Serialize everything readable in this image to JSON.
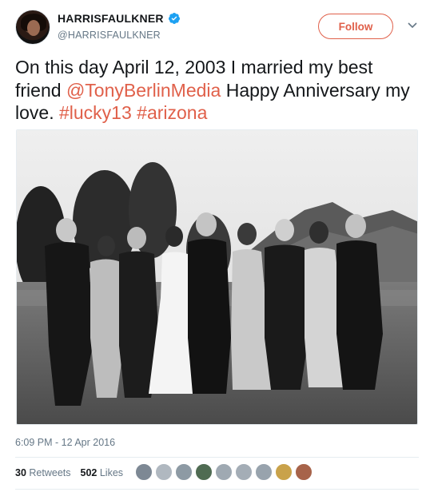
{
  "author": {
    "display_name": "HARRISFAULKNER",
    "handle": "@HARRISFAULKNER",
    "verified": true
  },
  "follow_label": "Follow",
  "tweet": {
    "text_parts": [
      {
        "text": "On this day April 12, 2003 I married my best friend ",
        "type": "text"
      },
      {
        "text": "@TonyBerlinMedia",
        "type": "mention"
      },
      {
        "text": " Happy Anniversary my love.  ",
        "type": "text"
      },
      {
        "text": "#lucky13",
        "type": "hashtag"
      },
      {
        "text": " ",
        "type": "text"
      },
      {
        "text": "#arizona",
        "type": "hashtag"
      }
    ]
  },
  "timestamp": "6:09 PM - 12 Apr 2016",
  "stats": {
    "retweets_count": "30",
    "retweets_label": "Retweets",
    "likes_count": "502",
    "likes_label": "Likes"
  },
  "liker_avatars": [
    "#7d8894",
    "#b0b8c0",
    "#8d9aa4",
    "#4f6b52",
    "#9fa9b2",
    "#a4adb6",
    "#98a3ad",
    "#c9a24a",
    "#a7634a"
  ],
  "colors": {
    "accent": "#e0604a",
    "verified": "#1da1f2",
    "muted": "#657786"
  }
}
